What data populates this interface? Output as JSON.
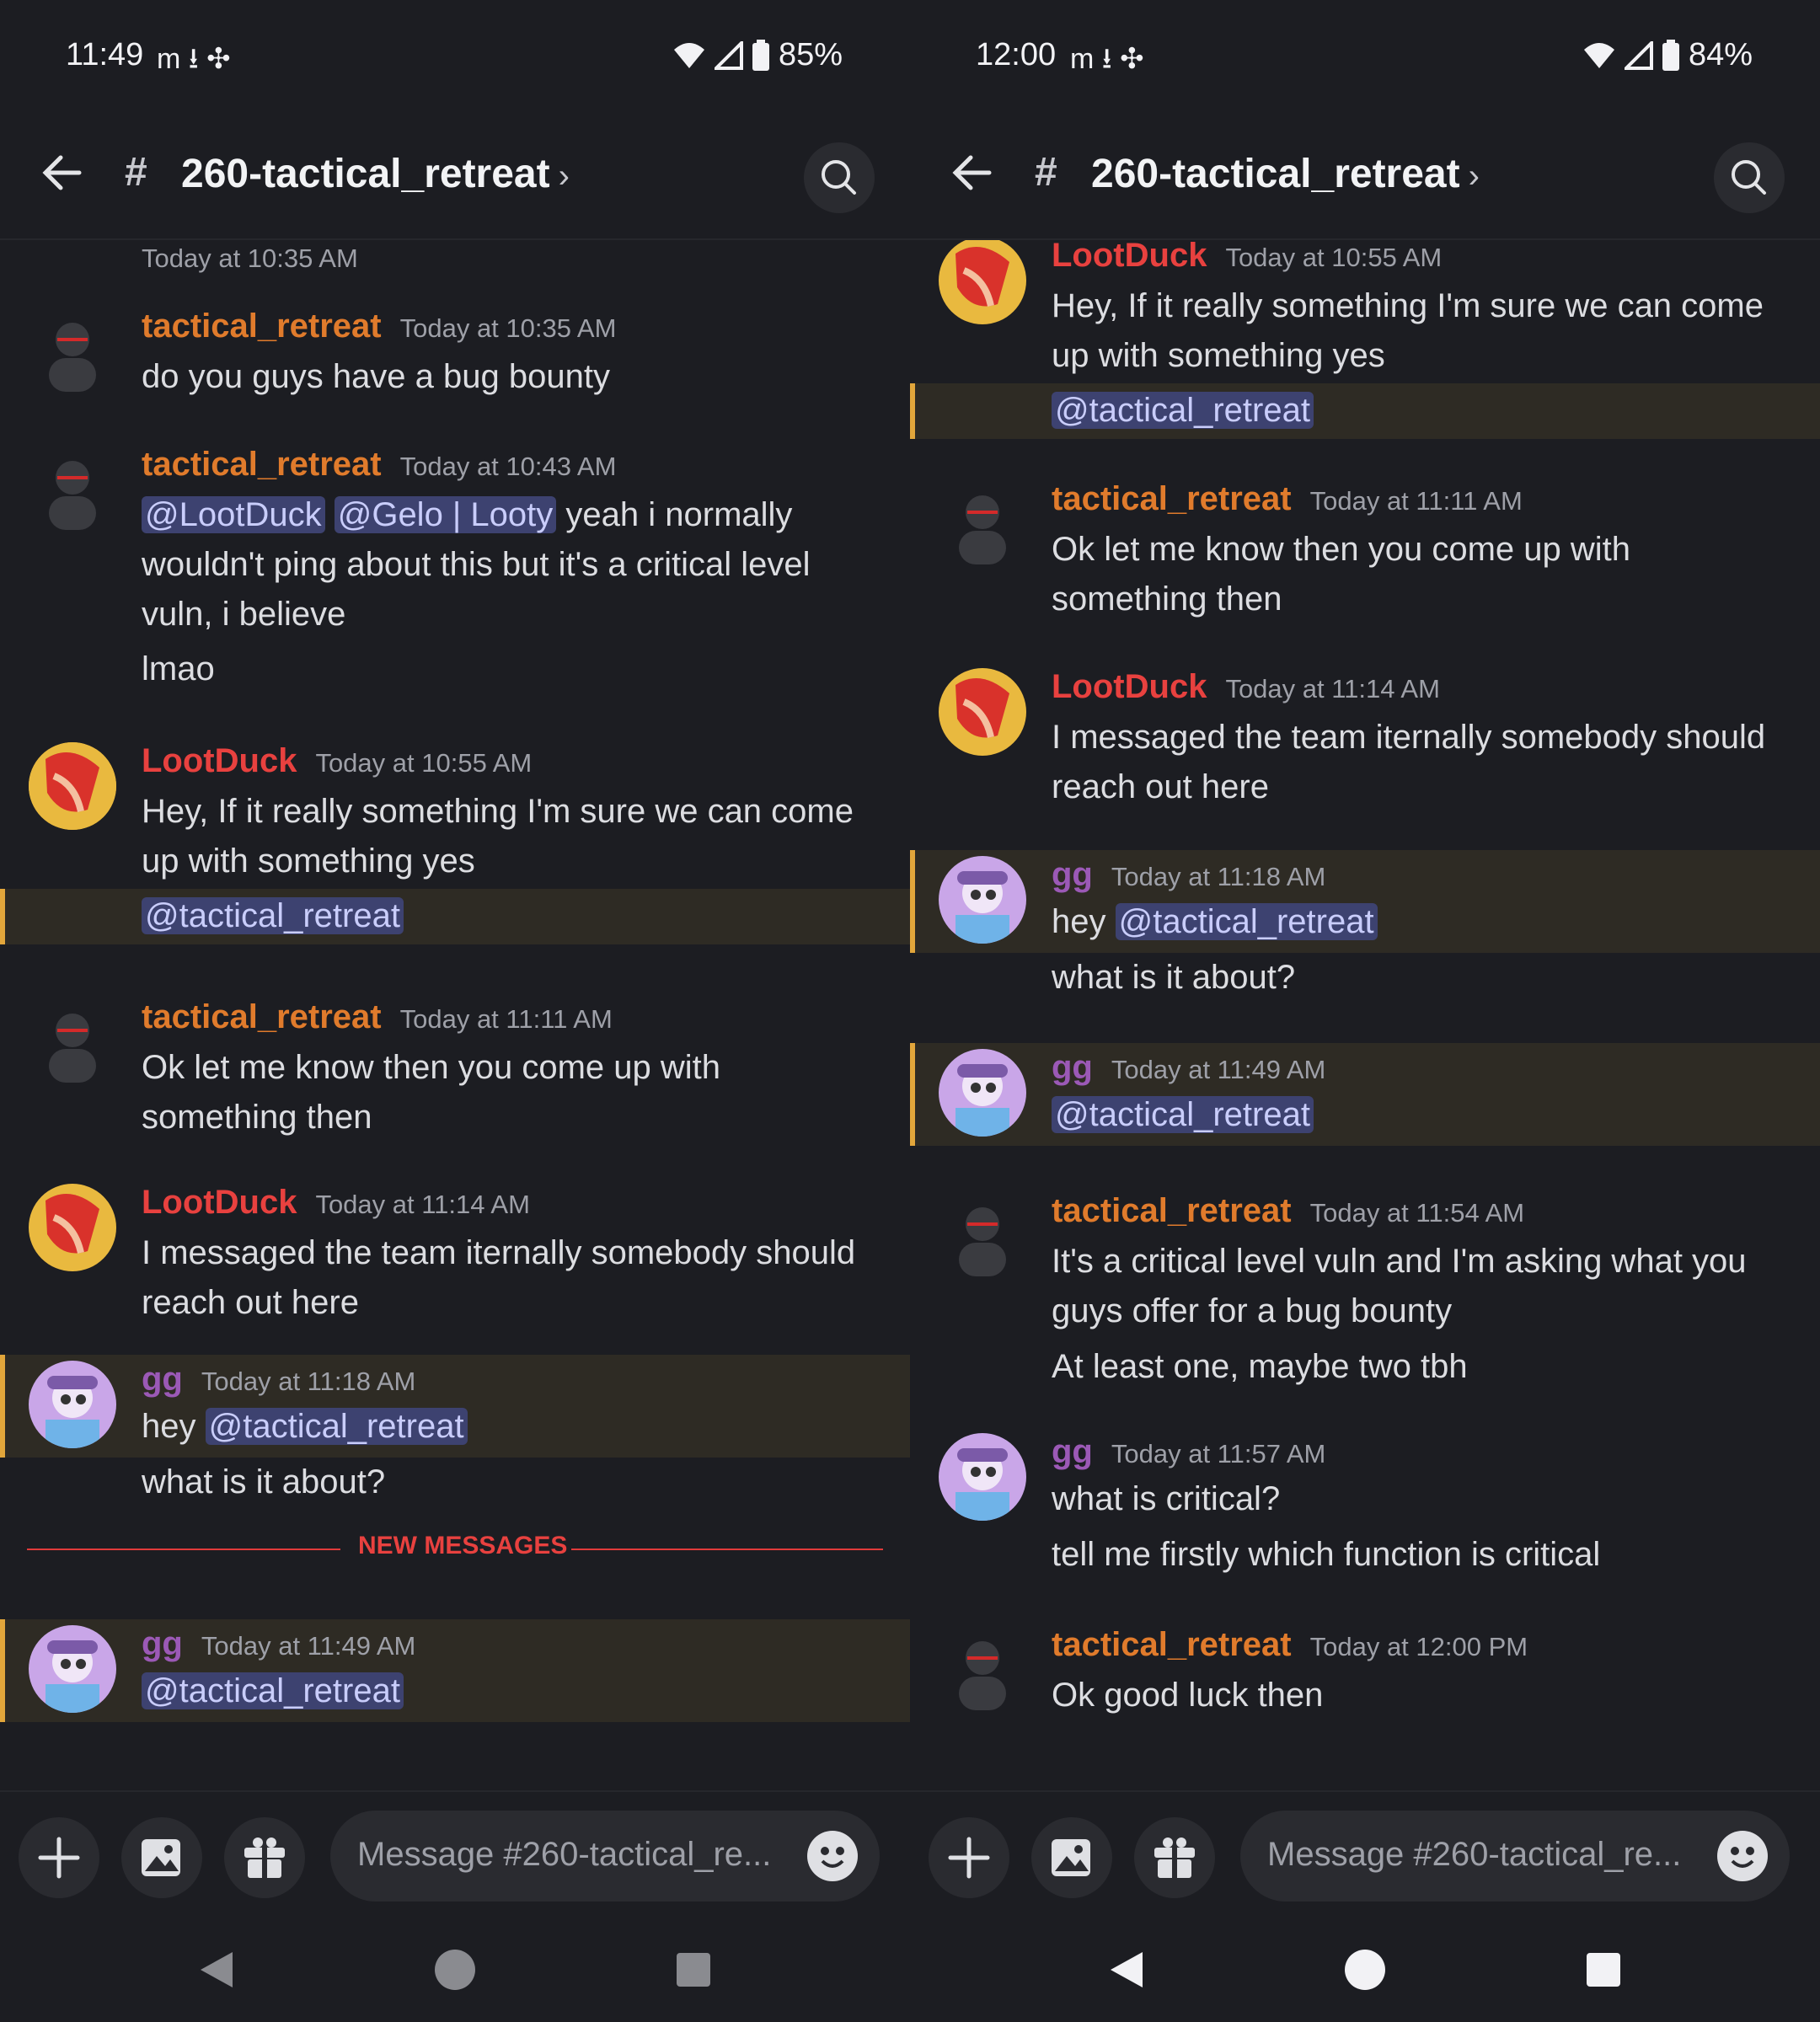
{
  "left": {
    "status": {
      "time": "11:49",
      "icons": "m  ⭳  ✣",
      "battery": "85%"
    },
    "channel": {
      "title": "260-tactical_retreat",
      "chevron": "›"
    },
    "top_timestamp": "Today at 10:35 AM",
    "messages": [
      {
        "user": "tactical_retreat",
        "time": "Today at 10:35 AM",
        "lines": [
          "do you guys have a bug bounty"
        ]
      },
      {
        "user": "tactical_retreat",
        "time": "Today at 10:43 AM",
        "mention1": "@LootDuck",
        "mention2": "@Gelo | Looty",
        "line1_rest": " yeah i normally",
        "lines": [
          "wouldn't ping about this but it's a critical level",
          "vuln, i believe",
          "lmao"
        ]
      },
      {
        "user": "LootDuck",
        "time": "Today at 10:55 AM",
        "lines": [
          "Hey, If it really something I'm sure we can come",
          "up with something yes"
        ],
        "mention": "@tactical_retreat"
      },
      {
        "user": "tactical_retreat",
        "time": "Today at 11:11 AM",
        "lines": [
          "Ok let me know then you come up with",
          "something then"
        ]
      },
      {
        "user": "LootDuck",
        "time": "Today at 11:14 AM",
        "lines": [
          "I messaged the team iternally somebody should",
          "reach out here"
        ]
      },
      {
        "user": "gg",
        "time": "Today at 11:18 AM",
        "prefix": "hey ",
        "mention": "@tactical_retreat",
        "lines": [
          "what is it about?"
        ]
      },
      {
        "user": "gg",
        "time": "Today at 11:49 AM",
        "mention": "@tactical_retreat"
      }
    ],
    "new_messages": "NEW MESSAGES",
    "composer_placeholder": "Message #260-tactical_re..."
  },
  "right": {
    "status": {
      "time": "12:00",
      "icons": "m  ⭳  ✣",
      "battery": "84%"
    },
    "channel": {
      "title": "260-tactical_retreat",
      "chevron": "›"
    },
    "messages": [
      {
        "user": "LootDuck",
        "time": "Today at 10:55 AM",
        "lines": [
          "Hey, If it really something I'm sure we can come",
          "up with something yes"
        ],
        "mention": "@tactical_retreat"
      },
      {
        "user": "tactical_retreat",
        "time": "Today at 11:11 AM",
        "lines": [
          "Ok let me know then you come up with",
          "something then"
        ]
      },
      {
        "user": "LootDuck",
        "time": "Today at 11:14 AM",
        "lines": [
          "I messaged the team iternally somebody should",
          "reach out here"
        ]
      },
      {
        "user": "gg",
        "time": "Today at 11:18 AM",
        "prefix": "hey ",
        "mention": "@tactical_retreat",
        "lines": [
          "what is it about?"
        ]
      },
      {
        "user": "gg",
        "time": "Today at 11:49 AM",
        "mention": "@tactical_retreat"
      },
      {
        "user": "tactical_retreat",
        "time": "Today at 11:54 AM",
        "lines": [
          "It's a critical level vuln and I'm asking what you",
          "guys offer for a bug bounty",
          "At least one, maybe two tbh"
        ]
      },
      {
        "user": "gg",
        "time": "Today at 11:57 AM",
        "lines": [
          "what is critical?",
          "tell me firstly which function is critical"
        ]
      },
      {
        "user": "tactical_retreat",
        "time": "Today at 12:00 PM",
        "lines": [
          "Ok good luck then"
        ]
      }
    ],
    "composer_placeholder": "Message #260-tactical_re..."
  },
  "colors": {
    "accent_mention_bg": "#3d4270",
    "highlight_border": "#e2a63b",
    "tactical": "#e07b2c",
    "lootduck": "#e8413f",
    "gg": "#9b59b6"
  },
  "icons": [
    "back-arrow-icon",
    "channel-thread-icon",
    "search-icon",
    "plus-icon",
    "image-icon",
    "gift-icon",
    "emoji-icon",
    "nav-back-icon",
    "nav-home-icon",
    "nav-recents-icon"
  ]
}
